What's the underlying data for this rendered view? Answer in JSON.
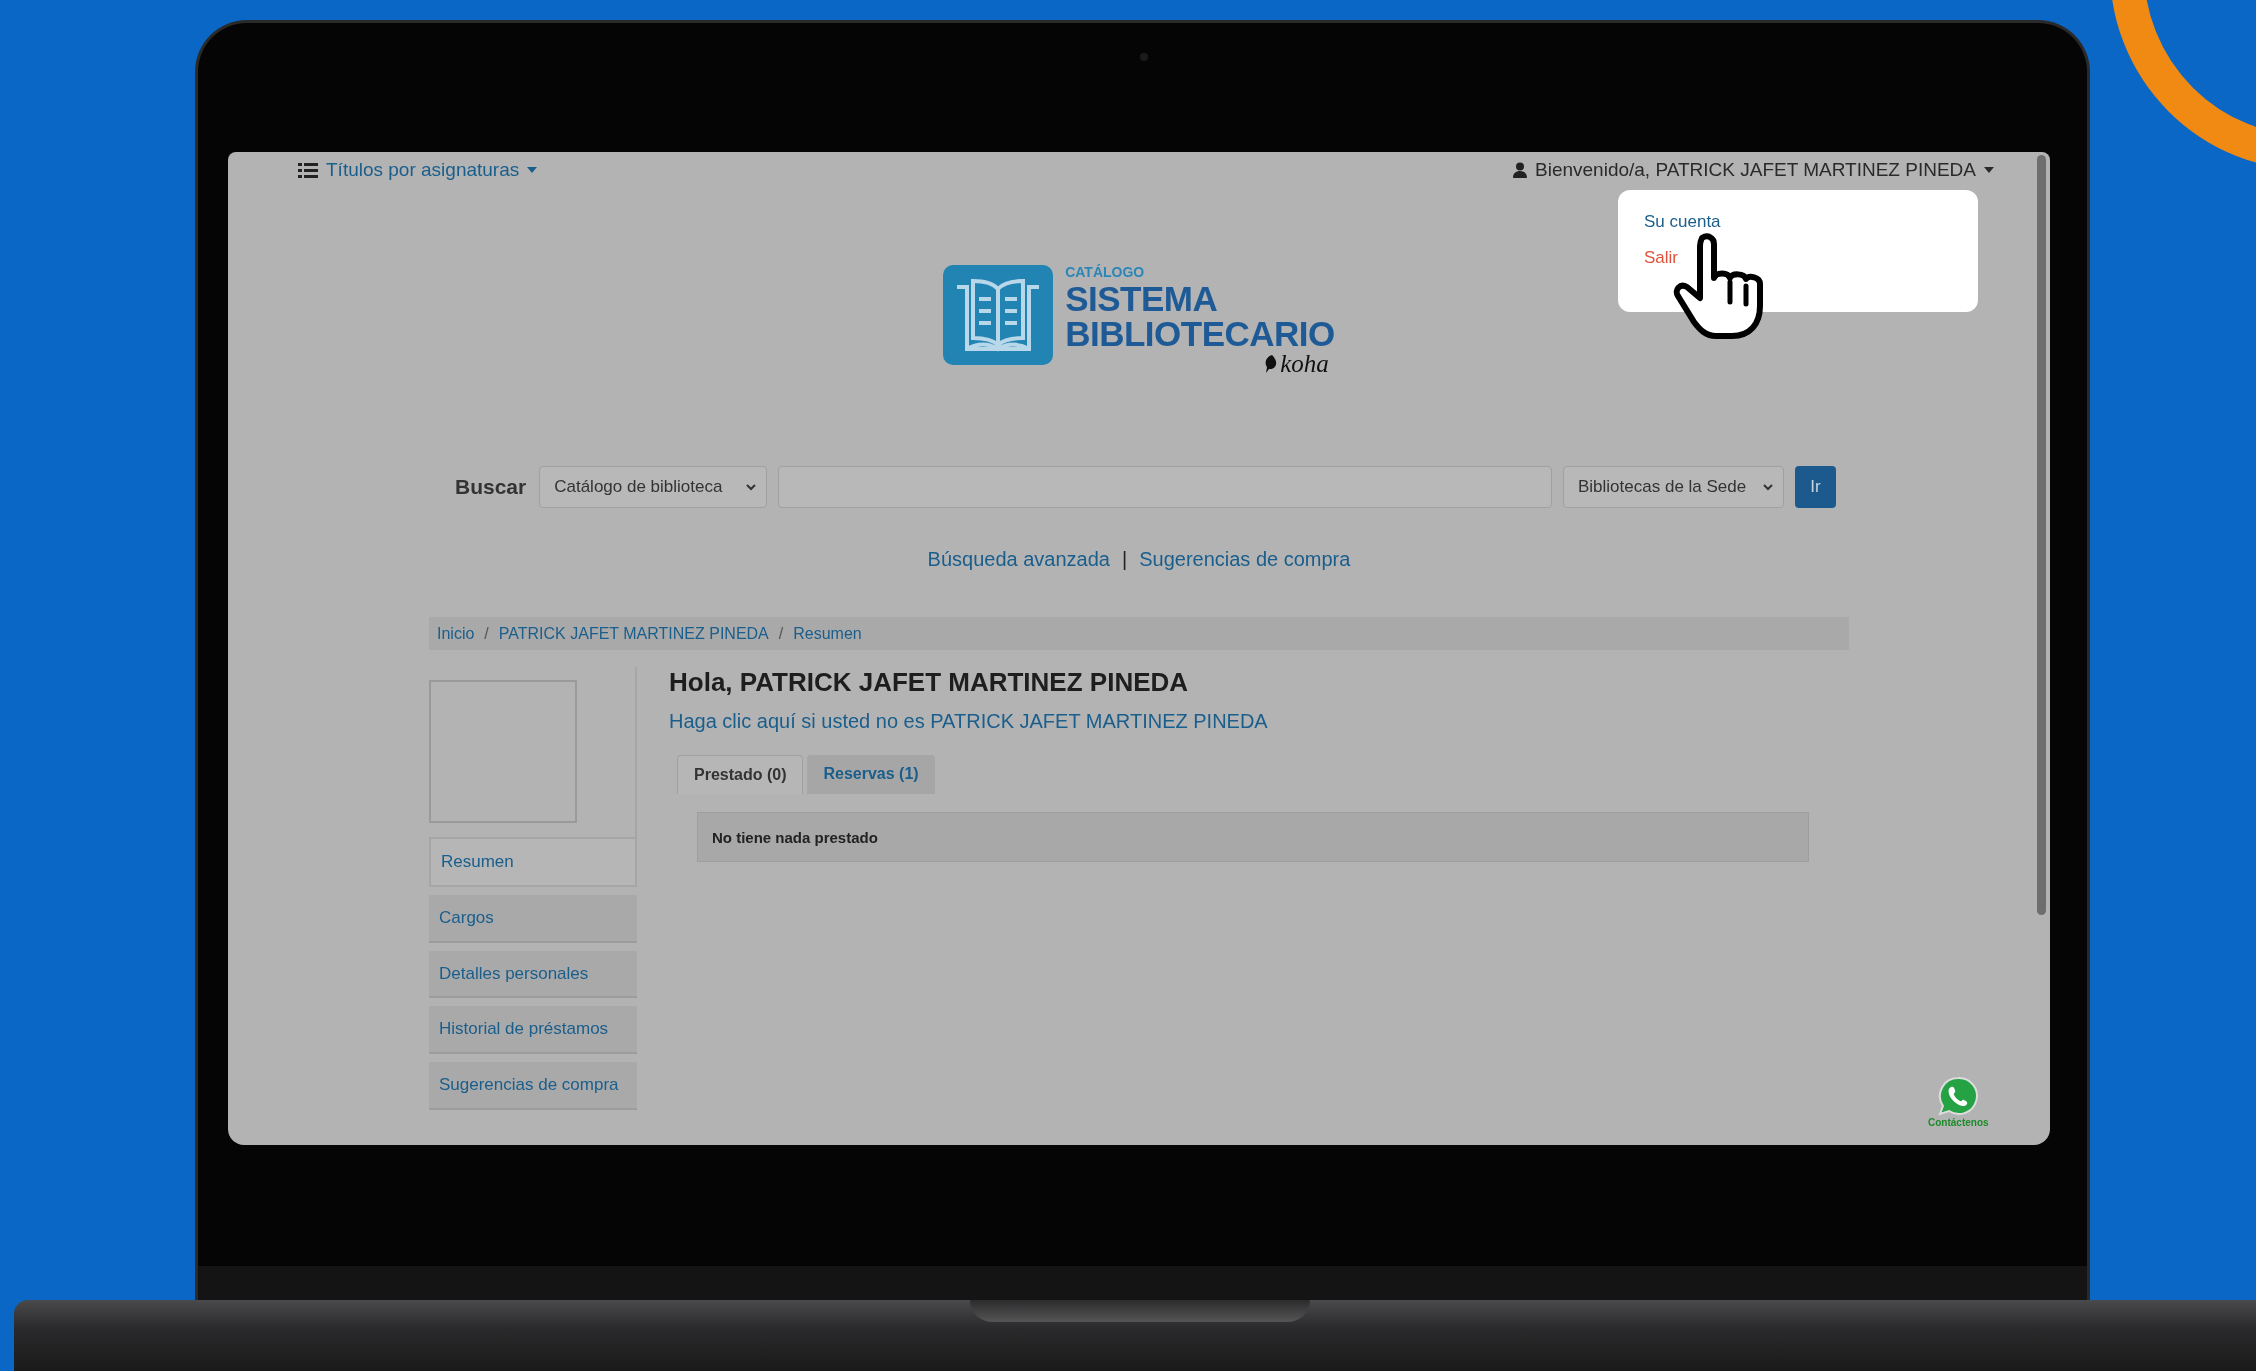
{
  "top_bar": {
    "menu_label": "Títulos por asignaturas",
    "user_greeting": "Bienvenido/a, PATRICK JAFET MARTINEZ PINEDA"
  },
  "user_menu": {
    "expanded": true,
    "items": [
      {
        "label": "Su cuenta",
        "kind": "link"
      },
      {
        "label": "Salir",
        "kind": "logout"
      }
    ]
  },
  "logo": {
    "overline": "CATÁLOGO",
    "line_1": "SISTEMA",
    "line_2": "BIBLIOTECARIO",
    "brand": "koha"
  },
  "search": {
    "label": "Buscar",
    "scope": "Catálogo de biblioteca",
    "library": "Bibliotecas de la Sede",
    "button": "Ir"
  },
  "search_links": {
    "items": [
      "Búsqueda avanzada",
      "Sugerencias de compra"
    ],
    "separator": "|"
  },
  "breadcrumb": {
    "items": [
      "Inicio",
      "PATRICK JAFET MARTINEZ PINEDA",
      "Resumen"
    ],
    "separator": "/"
  },
  "sidebar": {
    "items": [
      {
        "label": "Resumen",
        "selected": true
      },
      {
        "label": "Cargos",
        "selected": false
      },
      {
        "label": "Detalles personales",
        "selected": false
      },
      {
        "label": "Historial de préstamos",
        "selected": false
      },
      {
        "label": "Sugerencias de compra",
        "selected": false
      }
    ]
  },
  "greeting": {
    "title": "Hola, PATRICK JAFET MARTINEZ PINEDA",
    "not_you_link": "Haga clic aquí si usted no es PATRICK JAFET MARTINEZ PINEDA"
  },
  "tabs": [
    {
      "label": "Prestado (0)",
      "selected": true
    },
    {
      "label": "Reservas (1)",
      "selected": false
    }
  ],
  "tab_panel": {
    "message": "No tiene nada prestado"
  },
  "chat_widget": {
    "label": "Contáctenos"
  }
}
